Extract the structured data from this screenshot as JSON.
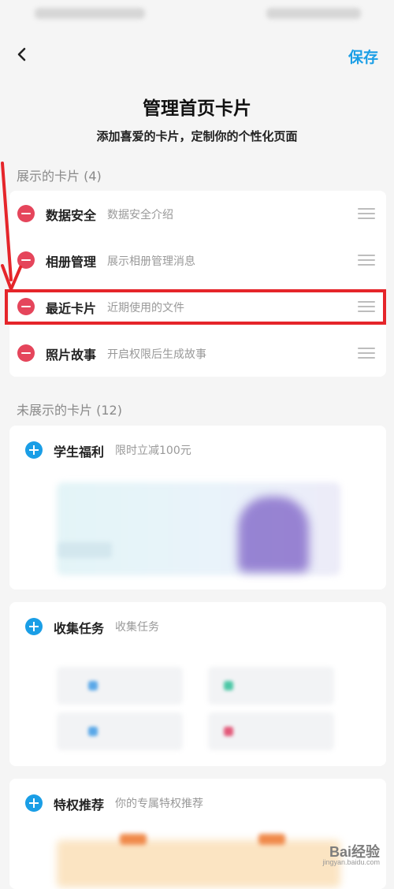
{
  "header": {
    "back_icon": "chevron-left-icon",
    "save_label": "保存",
    "title": "管理首页卡片",
    "subtitle": "添加喜爱的卡片，定制你的个性化页面"
  },
  "shown_section": {
    "label": "展示的卡片 (4)",
    "cards": [
      {
        "name": "数据安全",
        "desc": "数据安全介绍"
      },
      {
        "name": "相册管理",
        "desc": "展示相册管理消息"
      },
      {
        "name": "最近卡片",
        "desc": "近期使用的文件"
      },
      {
        "name": "照片故事",
        "desc": "开启权限后生成故事"
      }
    ]
  },
  "hidden_section": {
    "label": "未展示的卡片 (12)",
    "cards": [
      {
        "name": "学生福利",
        "desc": "限时立减100元"
      },
      {
        "name": "收集任务",
        "desc": "收集任务"
      },
      {
        "name": "特权推荐",
        "desc": "你的专属特权推荐"
      }
    ]
  },
  "watermark": {
    "brand": "Bai经验",
    "url": "jingyan.baidu.com"
  },
  "colors": {
    "accent": "#1a9ee6",
    "remove": "#e5455b",
    "highlight": "#e5252a"
  }
}
